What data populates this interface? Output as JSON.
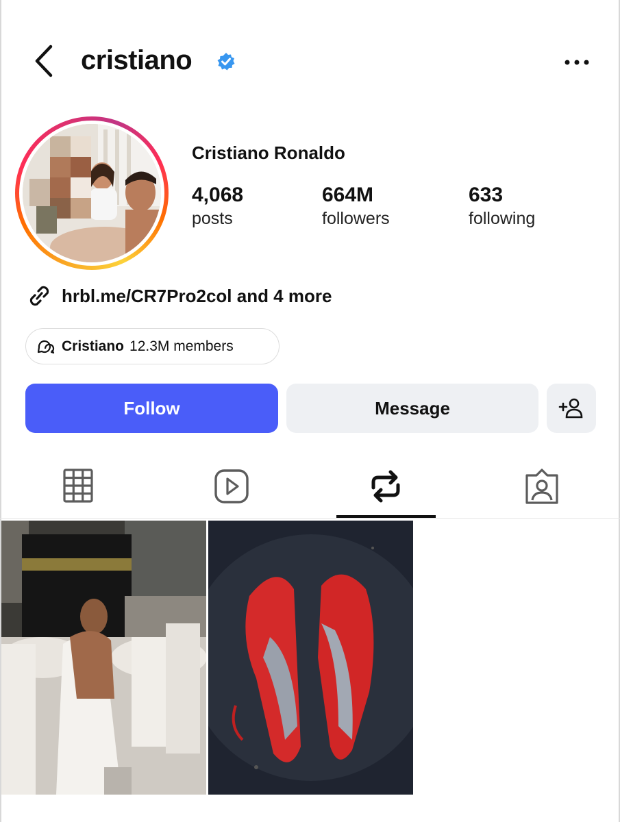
{
  "header": {
    "username": "cristiano",
    "icons": {
      "back": "chevron-left-icon",
      "verified": "verified-badge-icon",
      "more": "more-options-icon"
    }
  },
  "profile": {
    "full_name": "Cristiano Ronaldo",
    "stats": {
      "posts": {
        "value": "4,068",
        "label": "posts"
      },
      "followers": {
        "value": "664M",
        "label": "followers"
      },
      "following": {
        "value": "633",
        "label": "following"
      }
    },
    "link_text": "hrbl.me/CR7Pro2col and 4 more",
    "channel": {
      "name": "Cristiano",
      "members": "12.3M members"
    }
  },
  "actions": {
    "follow_label": "Follow",
    "message_label": "Message"
  },
  "tabs": [
    {
      "name": "posts-grid",
      "icon": "grid-icon"
    },
    {
      "name": "reels",
      "icon": "reels-icon"
    },
    {
      "name": "reposts",
      "icon": "repost-icon",
      "active": true
    },
    {
      "name": "tagged",
      "icon": "tagged-person-icon"
    }
  ],
  "colors": {
    "follow_button": "#4a5df9",
    "secondary_button": "#eef0f3",
    "verified_blue": "#3897f0"
  }
}
